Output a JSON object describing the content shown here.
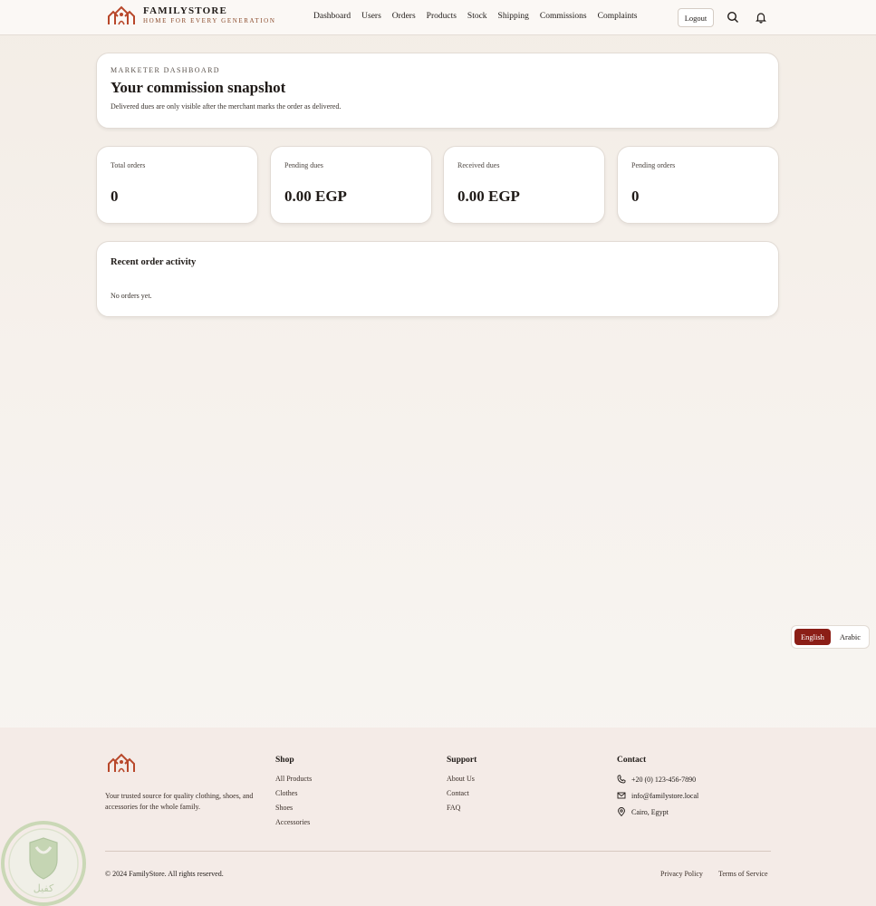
{
  "brand": {
    "name": "FAMILYSTORE",
    "tagline": "HOME FOR EVERY GENERATION"
  },
  "nav": {
    "items": [
      "Dashboard",
      "Users",
      "Orders",
      "Products",
      "Stock",
      "Shipping",
      "Commissions",
      "Complaints"
    ],
    "logout_label": "Logout"
  },
  "hero": {
    "eyebrow": "MARKETER DASHBOARD",
    "title": "Your commission snapshot",
    "subtitle": "Delivered dues are only visible after the merchant marks the order as delivered."
  },
  "stats": [
    {
      "label": "Total orders",
      "value": "0"
    },
    {
      "label": "Pending dues",
      "value": "0.00 EGP"
    },
    {
      "label": "Received dues",
      "value": "0.00 EGP"
    },
    {
      "label": "Pending orders",
      "value": "0"
    }
  ],
  "activity": {
    "title": "Recent order activity",
    "empty": "No orders yet."
  },
  "language": {
    "active": "English",
    "other": "Arabic"
  },
  "footer": {
    "about": "Your trusted source for quality clothing, shoes, and accessories for the whole family.",
    "shop": {
      "title": "Shop",
      "links": [
        "All Products",
        "Clothes",
        "Shoes",
        "Accessories"
      ]
    },
    "support": {
      "title": "Support",
      "links": [
        "About Us",
        "Contact",
        "FAQ"
      ]
    },
    "contact": {
      "title": "Contact",
      "phone": "+20 (0) 123-456-7890",
      "email": "info@familystore.local",
      "address": "Cairo, Egypt"
    },
    "copyright": "© 2024 FamilyStore. All rights reserved.",
    "privacy": "Privacy Policy",
    "terms": "Terms of Service"
  },
  "watermark": {
    "text": "كفيل"
  },
  "colors": {
    "accent": "#8b1e16",
    "logo": "#b8472a",
    "footer_bg": "#f4ebe7"
  }
}
